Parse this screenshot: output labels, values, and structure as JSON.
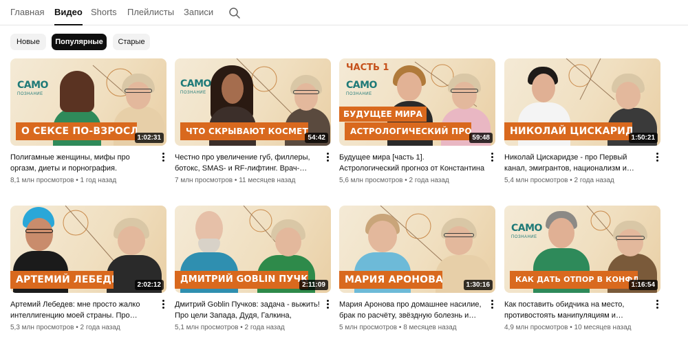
{
  "tabs": [
    {
      "label": "Главная",
      "active": false
    },
    {
      "label": "Видео",
      "active": true
    },
    {
      "label": "Shorts",
      "active": false
    },
    {
      "label": "Плейлисты",
      "active": false
    },
    {
      "label": "Записи",
      "active": false
    }
  ],
  "search_icon": "search-icon",
  "chips": [
    {
      "label": "Новые",
      "active": false
    },
    {
      "label": "Популярные",
      "active": true
    },
    {
      "label": "Старые",
      "active": false
    }
  ],
  "brand_colors": {
    "strip": "#d9691e",
    "logo": "#1f7a78"
  },
  "logo": {
    "top": "САМО",
    "bottom": "ПОЗНАНИЕ"
  },
  "videos": [
    {
      "thumb_text": "О СЕКСЕ ПО-ВЗРОСЛОМУ",
      "duration": "1:02:31",
      "title": "Полигамные женщины, мифы про оргазм, диеты и порнография. Сексолог…",
      "views": "8,1 млн просмотров",
      "age": "1 год назад"
    },
    {
      "thumb_text": "ЧТО СКРЫВАЮТ КОСМЕТОЛОГИ?",
      "duration": "54:42",
      "title": "Честно про увеличение губ, филлеры, ботокс, SMAS- и RF-лифтинг. Врач-…",
      "views": "7 млн просмотров",
      "age": "11 месяцев назад"
    },
    {
      "thumb_part": "ЧАСТЬ 1",
      "thumb_text_top": "БУДУЩЕЕ МИРА",
      "thumb_text": "АСТРОЛОГИЧЕСКИЙ ПРОГНОЗ",
      "duration": "59:48",
      "title": "Будущее мира [часть 1]. Астрологический прогноз от Константина Дарагана",
      "views": "5,6 млн просмотров",
      "age": "2 года назад"
    },
    {
      "thumb_text": "НИКОЛАЙ ЦИСКАРИДЗЕ",
      "duration": "1:50:21",
      "title": "Николай Цискаридзе - про Первый канал, эмигрантов, национализм и…",
      "views": "5,4 млн просмотров",
      "age": "2 года назад"
    },
    {
      "thumb_text": "АРТЕМИЙ ЛЕБЕДЕВ",
      "duration": "2:02:12",
      "title": "Артемий Лебедев: мне просто жалко интеллигенцию моей страны. Про…",
      "views": "5,3 млн просмотров",
      "age": "2 года назад"
    },
    {
      "thumb_text": "ДМИТРИЙ GOBLIN ПУЧКОВ",
      "duration": "2:11:09",
      "title": "Дмитрий Goblin Пучков: задача - выжить! Про цели Запада, Дудя, Галкина, котико…",
      "views": "5,1 млн просмотров",
      "age": "2 года назад"
    },
    {
      "thumb_text": "МАРИЯ АРОНОВА",
      "duration": "1:30:16",
      "title": "Мария Аронова про домашнее насилие, брак по расчёту, звёздную болезнь и…",
      "views": "5 млн просмотров",
      "age": "8 месяцев назад"
    },
    {
      "thumb_text": "КАК ДАТЬ ОТПОР В КОНФЛИКТЕ?",
      "duration": "1:16:54",
      "title": "Как поставить обидчика на место, противостоять манипуляциям и…",
      "views": "4,9 млн просмотров",
      "age": "10 месяцев назад"
    }
  ]
}
